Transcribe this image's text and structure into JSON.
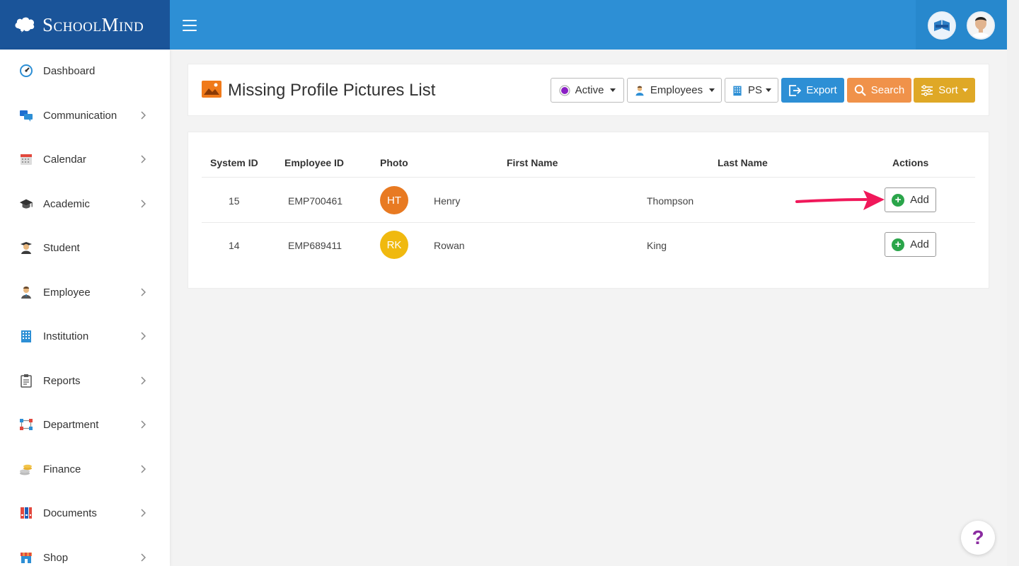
{
  "brand": {
    "name": "SchoolMind"
  },
  "sidebar": {
    "items": [
      {
        "label": "Dashboard",
        "icon": "dashboard-icon",
        "has_chevron": false
      },
      {
        "label": "Communication",
        "icon": "chat-icon",
        "has_chevron": true
      },
      {
        "label": "Calendar",
        "icon": "calendar-icon",
        "has_chevron": true
      },
      {
        "label": "Academic",
        "icon": "graduation-cap-icon",
        "has_chevron": true
      },
      {
        "label": "Student",
        "icon": "student-icon",
        "has_chevron": false
      },
      {
        "label": "Employee",
        "icon": "employee-icon",
        "has_chevron": true
      },
      {
        "label": "Institution",
        "icon": "building-icon",
        "has_chevron": true
      },
      {
        "label": "Reports",
        "icon": "clipboard-icon",
        "has_chevron": true
      },
      {
        "label": "Department",
        "icon": "org-chart-icon",
        "has_chevron": true
      },
      {
        "label": "Finance",
        "icon": "coins-icon",
        "has_chevron": true
      },
      {
        "label": "Documents",
        "icon": "binders-icon",
        "has_chevron": true
      },
      {
        "label": "Shop",
        "icon": "shop-icon",
        "has_chevron": true
      }
    ]
  },
  "header": {
    "title": "Missing Profile Pictures List",
    "filters": {
      "status": "Active",
      "type": "Employees",
      "school": "PS"
    },
    "buttons": {
      "export": "Export",
      "search": "Search",
      "sort": "Sort"
    }
  },
  "table": {
    "columns": [
      "System ID",
      "Employee ID",
      "Photo",
      "First Name",
      "Last Name",
      "Actions"
    ],
    "rows": [
      {
        "system_id": "15",
        "employee_id": "EMP700461",
        "initials": "HT",
        "first_name": "Henry",
        "last_name": "Thompson",
        "action": "Add",
        "avatar_color": "#e87a22"
      },
      {
        "system_id": "14",
        "employee_id": "EMP689411",
        "initials": "RK",
        "first_name": "Rowan",
        "last_name": "King",
        "action": "Add",
        "avatar_color": "#f0b90f"
      }
    ]
  },
  "help": {
    "label": "?"
  },
  "colors": {
    "brand_dark": "#1a5499",
    "topbar": "#2d8fd5",
    "export": "#2d8fd5",
    "search": "#f0924a",
    "sort": "#dfa826",
    "add_icon": "#2aa54a",
    "arrow": "#f0185a"
  }
}
